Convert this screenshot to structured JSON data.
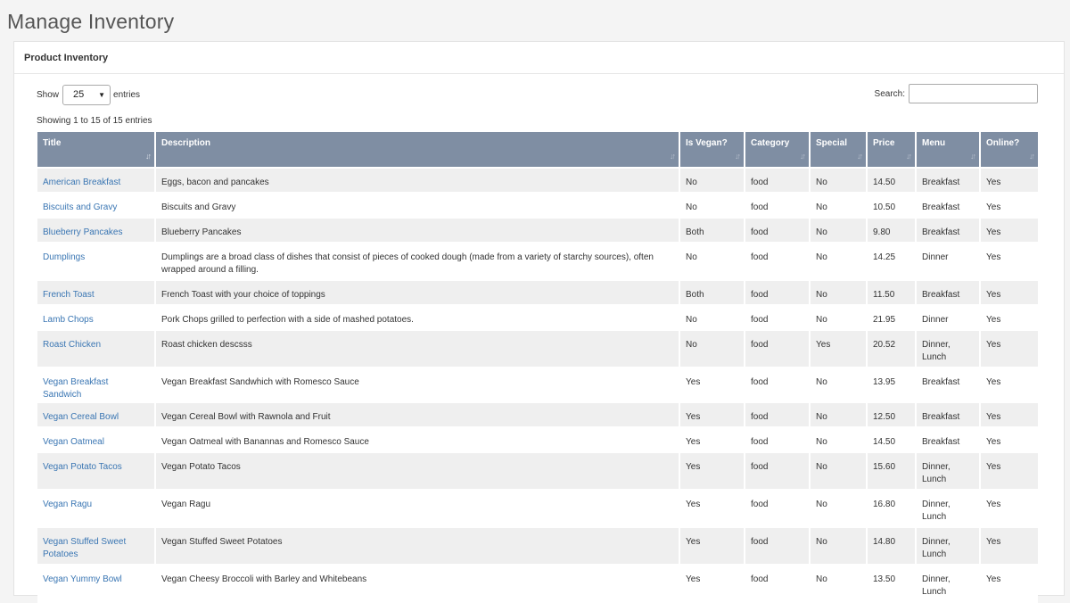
{
  "page_title": "Manage Inventory",
  "panel_title": "Product Inventory",
  "length": {
    "show_label": "Show",
    "value": "25",
    "entries_label": "entries"
  },
  "search": {
    "label": "Search:",
    "value": ""
  },
  "info": "Showing 1 to 15 of 15 entries",
  "columns": [
    "Title",
    "Description",
    "Is Vegan?",
    "Category",
    "Special",
    "Price",
    "Menu",
    "Online?"
  ],
  "rows": [
    {
      "title": "American Breakfast",
      "description": "Eggs, bacon and pancakes",
      "vegan": "No",
      "category": "food",
      "special": "No",
      "price": "14.50",
      "menu": "Breakfast",
      "online": "Yes"
    },
    {
      "title": "Biscuits and Gravy",
      "description": "Biscuits and Gravy",
      "vegan": "No",
      "category": "food",
      "special": "No",
      "price": "10.50",
      "menu": "Breakfast",
      "online": "Yes"
    },
    {
      "title": "Blueberry Pancakes",
      "description": "Blueberry Pancakes",
      "vegan": "Both",
      "category": "food",
      "special": "No",
      "price": "9.80",
      "menu": "Breakfast",
      "online": "Yes"
    },
    {
      "title": "Dumplings",
      "description": "Dumplings are a broad class of dishes that consist of pieces of cooked dough (made from a variety of starchy sources), often wrapped around a filling.",
      "vegan": "No",
      "category": "food",
      "special": "No",
      "price": "14.25",
      "menu": "Dinner",
      "online": "Yes"
    },
    {
      "title": "French Toast",
      "description": "French Toast with your choice of toppings",
      "vegan": "Both",
      "category": "food",
      "special": "No",
      "price": "11.50",
      "menu": "Breakfast",
      "online": "Yes"
    },
    {
      "title": "Lamb Chops",
      "description": "Pork Chops grilled to perfection with a side of mashed potatoes.",
      "vegan": "No",
      "category": "food",
      "special": "No",
      "price": "21.95",
      "menu": "Dinner",
      "online": "Yes"
    },
    {
      "title": "Roast Chicken",
      "description": "Roast chicken descsss",
      "vegan": "No",
      "category": "food",
      "special": "Yes",
      "price": "20.52",
      "menu": "Dinner, Lunch",
      "online": "Yes"
    },
    {
      "title": "Vegan Breakfast Sandwich",
      "description": "Vegan Breakfast Sandwhich with Romesco Sauce",
      "vegan": "Yes",
      "category": "food",
      "special": "No",
      "price": "13.95",
      "menu": "Breakfast",
      "online": "Yes"
    },
    {
      "title": "Vegan Cereal Bowl",
      "description": "Vegan Cereal Bowl with Rawnola and Fruit",
      "vegan": "Yes",
      "category": "food",
      "special": "No",
      "price": "12.50",
      "menu": "Breakfast",
      "online": "Yes"
    },
    {
      "title": "Vegan Oatmeal",
      "description": "Vegan Oatmeal with Banannas and Romesco Sauce",
      "vegan": "Yes",
      "category": "food",
      "special": "No",
      "price": "14.50",
      "menu": "Breakfast",
      "online": "Yes"
    },
    {
      "title": "Vegan Potato Tacos",
      "description": "Vegan Potato Tacos",
      "vegan": "Yes",
      "category": "food",
      "special": "No",
      "price": "15.60",
      "menu": "Dinner, Lunch",
      "online": "Yes"
    },
    {
      "title": "Vegan Ragu",
      "description": "Vegan Ragu",
      "vegan": "Yes",
      "category": "food",
      "special": "No",
      "price": "16.80",
      "menu": "Dinner, Lunch",
      "online": "Yes"
    },
    {
      "title": "Vegan Stuffed Sweet Potatoes",
      "description": "Vegan Stuffed Sweet Potatoes",
      "vegan": "Yes",
      "category": "food",
      "special": "No",
      "price": "14.80",
      "menu": "Dinner, Lunch",
      "online": "Yes"
    },
    {
      "title": "Vegan Yummy Bowl",
      "description": "Vegan Cheesy Broccoli with Barley and Whitebeans",
      "vegan": "Yes",
      "category": "food",
      "special": "No",
      "price": "13.50",
      "menu": "Dinner, Lunch",
      "online": "Yes"
    }
  ],
  "colors": {
    "header_bg": "#7f8ea3",
    "link": "#3a76b3",
    "stripe": "#efefef"
  },
  "icons": {
    "sort_active": "sort-ascending-icon",
    "sort": "sort-both-icon",
    "select_caret": "chevron-down-icon"
  }
}
